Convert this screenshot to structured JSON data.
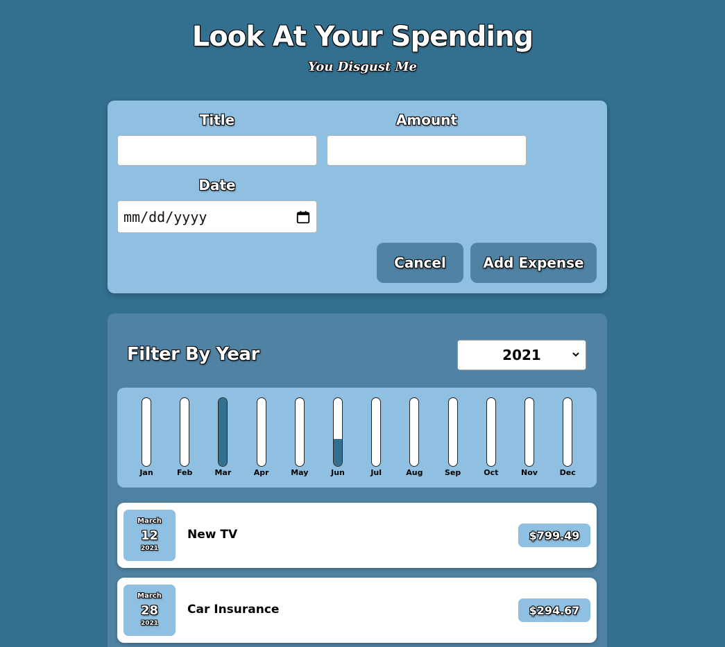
{
  "header": {
    "title": "Look At Your Spending",
    "subtitle": "You Disgust Me"
  },
  "form": {
    "title_label": "Title",
    "title_value": "",
    "amount_label": "Amount",
    "amount_value": "",
    "date_label": "Date",
    "date_placeholder": "mm/dd/yyyy",
    "cancel_label": "Cancel",
    "submit_label": "Add Expense"
  },
  "filter": {
    "label": "Filter By Year",
    "selected_year": "2021"
  },
  "chart_data": {
    "type": "bar",
    "categories": [
      "Jan",
      "Feb",
      "Mar",
      "Apr",
      "May",
      "Jun",
      "Jul",
      "Aug",
      "Sep",
      "Oct",
      "Nov",
      "Dec"
    ],
    "values": [
      0,
      0,
      1.0,
      0,
      0,
      0.4,
      0,
      0,
      0,
      0,
      0,
      0
    ],
    "ylim": [
      0,
      1
    ]
  },
  "expenses": [
    {
      "month": "March",
      "day": "12",
      "year": "2021",
      "title": "New TV",
      "amount": "$799.49"
    },
    {
      "month": "March",
      "day": "28",
      "year": "2021",
      "title": "Car Insurance",
      "amount": "$294.67"
    }
  ],
  "colors": {
    "background": "#33708f",
    "card_light": "#8fc0e1",
    "card_dark": "#4f82a3",
    "bar_fill": "#33708f"
  }
}
